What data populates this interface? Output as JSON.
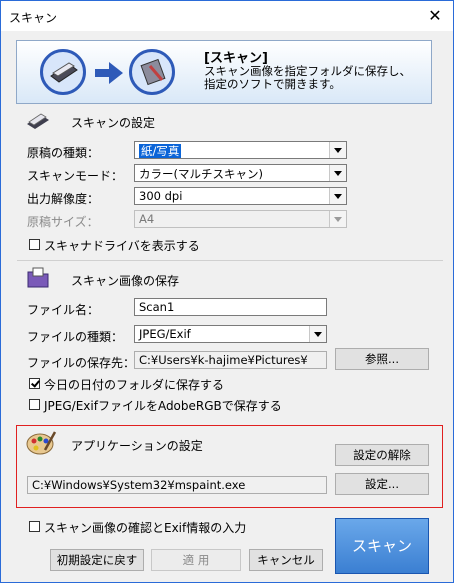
{
  "window": {
    "title": "スキャン"
  },
  "banner": {
    "title": "[スキャン]",
    "description_line1": "スキャン画像を指定フォルダに保存し、",
    "description_line2": "指定のソフトで開きます。"
  },
  "scan_settings": {
    "section_title": "スキャンの設定",
    "doc_type_label": "原稿の種類：",
    "doc_type_value": "紙/写真",
    "scan_mode_label": "スキャンモード：",
    "scan_mode_value": "カラー(マルチスキャン)",
    "resolution_label": "出力解像度：",
    "resolution_value": "300 dpi",
    "size_label": "原稿サイズ：",
    "size_value": "A4",
    "show_driver_label": "スキャナドライバを表示する",
    "show_driver_checked": false
  },
  "save_settings": {
    "section_title": "スキャン画像の保存",
    "file_name_label": "ファイル名：",
    "file_name_value": "Scan1",
    "file_type_label": "ファイルの種類：",
    "file_type_value": "JPEG/Exif",
    "save_to_label": "ファイルの保存先：",
    "save_to_value": "C:¥Users¥k-hajime¥Pictures¥",
    "browse_label": "参照...",
    "date_folder_label": "今日の日付のフォルダに保存する",
    "date_folder_checked": true,
    "adobergb_label": "JPEG/ExifファイルをAdobeRGBで保存する",
    "adobergb_checked": false
  },
  "app_settings": {
    "section_title": "アプリケーションの設定",
    "clear_label": "設定の解除",
    "app_path": "C:¥Windows¥System32¥mspaint.exe",
    "settings_label": "設定..."
  },
  "footer": {
    "confirm_label": "スキャン画像の確認とExif情報の入力",
    "confirm_checked": false,
    "reset_label": "初期設定に戻す",
    "apply_label": "適 用",
    "cancel_label": "キャンセル",
    "scan_label": "スキャン"
  }
}
